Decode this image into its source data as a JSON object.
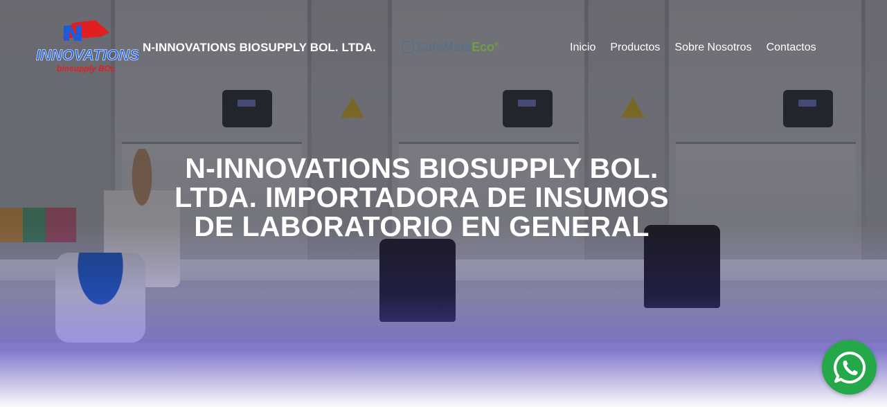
{
  "header": {
    "brand_title": "N-INNOVATIONS BIOSUPPLY BOL. LTDA.",
    "logo": {
      "name": "INNOVATIONS",
      "subtitle": "biosupply BOL",
      "colors": {
        "primary": "#1f5bd6",
        "accent": "#e02020"
      }
    },
    "partner_logo": {
      "text": "SafeMate",
      "suffix": "Eco",
      "mark": "®"
    }
  },
  "nav": {
    "items": [
      {
        "label": "Inicio"
      },
      {
        "label": "Productos"
      },
      {
        "label": "Sobre Nosotros"
      },
      {
        "label": "Contactos"
      }
    ]
  },
  "hero": {
    "headline": "N-INNOVATIONS BIOSUPPLY BOL. LTDA. IMPORTADORA DE INSUMOS DE LABORATORIO EN GENERAL"
  },
  "floating": {
    "whatsapp": {
      "icon": "whatsapp-icon",
      "color": "#25a84a"
    }
  }
}
